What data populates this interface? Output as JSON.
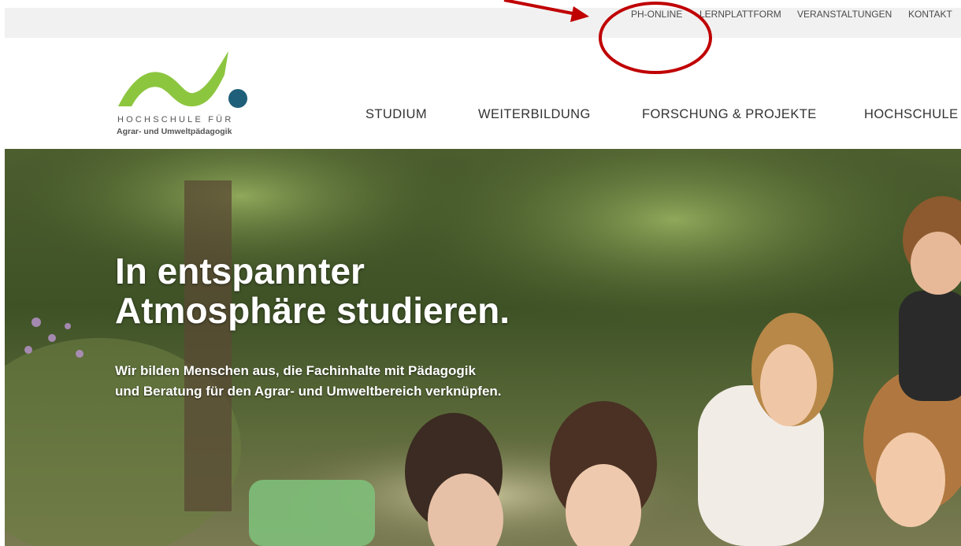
{
  "utility_nav": {
    "items": [
      "PH-ONLINE",
      "LERNPLATTFORM",
      "VERANSTALTUNGEN",
      "KONTAKT"
    ]
  },
  "logo": {
    "line1": "HOCHSCHULE FÜR",
    "line2": "Agrar- und Umweltpädagogik",
    "colors": {
      "wave": "#8cc63f",
      "dot": "#1f5f7a"
    }
  },
  "main_nav": {
    "items": [
      "STUDIUM",
      "WEITERBILDUNG",
      "FORSCHUNG & PROJEKTE",
      "HOCHSCHULE"
    ]
  },
  "hero": {
    "title": "In entspannter\nAtmosphäre studieren.",
    "subtitle": "Wir bilden Menschen aus, die Fachinhalte mit Pädagogik\nund Beratung für den Agrar- und Umweltbereich verknüpfen."
  },
  "annotation": {
    "color": "#c00000"
  }
}
